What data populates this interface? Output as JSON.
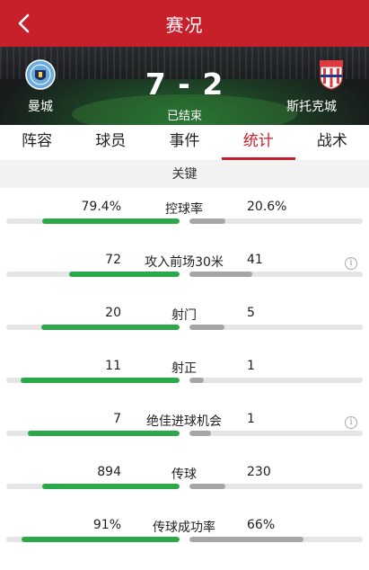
{
  "header": {
    "title": "赛况",
    "back_icon": "chevron-left-icon"
  },
  "match": {
    "home_team": "曼城",
    "away_team": "斯托克城",
    "score": "7 - 2",
    "status": "已结束"
  },
  "tabs": [
    {
      "label": "阵容",
      "active": false
    },
    {
      "label": "球员",
      "active": false
    },
    {
      "label": "事件",
      "active": false
    },
    {
      "label": "统计",
      "active": true
    },
    {
      "label": "战术",
      "active": false
    }
  ],
  "section": {
    "title": "关键"
  },
  "colors": {
    "accent": "#c8202b",
    "home_bar": "#2ba84a",
    "away_bar": "#a6a6a6"
  },
  "stats": [
    {
      "label": "控球率",
      "home": "79.4%",
      "away": "20.6%",
      "home_share": 0.794,
      "away_share": 0.206,
      "info": false
    },
    {
      "label": "攻入前场30米",
      "home": "72",
      "away": "41",
      "home_share": 0.637,
      "away_share": 0.363,
      "info": true
    },
    {
      "label": "射门",
      "home": "20",
      "away": "5",
      "home_share": 0.8,
      "away_share": 0.2,
      "info": false
    },
    {
      "label": "射正",
      "home": "11",
      "away": "1",
      "home_share": 0.917,
      "away_share": 0.083,
      "info": false
    },
    {
      "label": "绝佳进球机会",
      "home": "7",
      "away": "1",
      "home_share": 0.875,
      "away_share": 0.125,
      "info": true
    },
    {
      "label": "传球",
      "home": "894",
      "away": "230",
      "home_share": 0.795,
      "away_share": 0.205,
      "info": false
    },
    {
      "label": "传球成功率",
      "home": "91%",
      "away": "66%",
      "home_share": 0.91,
      "away_share": 0.66,
      "info": false
    }
  ]
}
